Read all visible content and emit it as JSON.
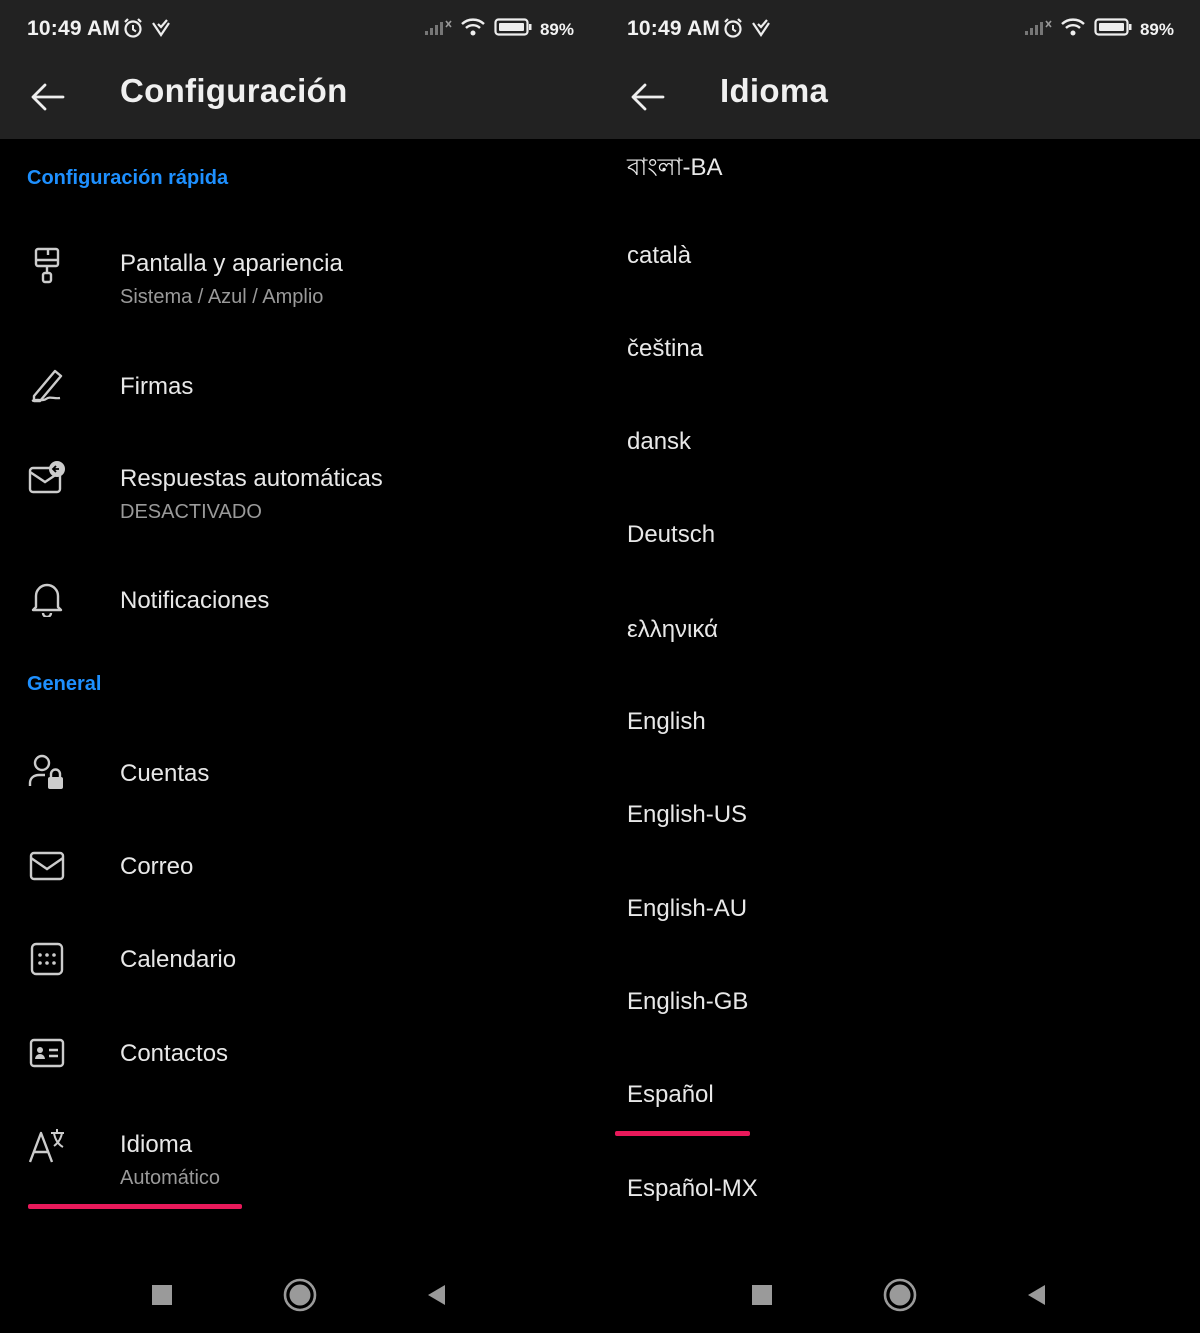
{
  "status_bar": {
    "time": "10:49 AM",
    "battery_percent": "89%",
    "icons": [
      "alarm-icon",
      "notification-check-icon",
      "signal-icon",
      "wifi-icon",
      "battery-icon"
    ]
  },
  "left": {
    "title": "Configuración",
    "sections": {
      "quick": "Configuración rápida",
      "general": "General"
    },
    "items": [
      {
        "title": "Pantalla y apariencia",
        "subtitle": "Sistema / Azul / Amplio",
        "icon": "paint-roller-icon"
      },
      {
        "title": "Firmas",
        "icon": "signature-pen-icon"
      },
      {
        "title": "Respuestas automáticas",
        "subtitle": "DESACTIVADO",
        "icon": "auto-reply-mail-icon"
      },
      {
        "title": "Notificaciones",
        "icon": "bell-icon"
      },
      {
        "title": "Cuentas",
        "icon": "account-lock-icon"
      },
      {
        "title": "Correo",
        "icon": "mail-icon"
      },
      {
        "title": "Calendario",
        "icon": "calendar-icon"
      },
      {
        "title": "Contactos",
        "icon": "contact-card-icon"
      },
      {
        "title": "Idioma",
        "subtitle": "Automático",
        "icon": "language-icon"
      }
    ]
  },
  "right": {
    "title": "Idioma",
    "languages": [
      "বাংলা-BA",
      "català",
      "čeština",
      "dansk",
      "Deutsch",
      "ελληνικά",
      "English",
      "English-US",
      "English-AU",
      "English-GB",
      "Español",
      "Español-MX"
    ]
  },
  "highlight_color": "#e8195a",
  "accent_color": "#1e90ff",
  "nav_icons": [
    "recent-apps-square-icon",
    "home-circle-icon",
    "back-triangle-icon"
  ]
}
